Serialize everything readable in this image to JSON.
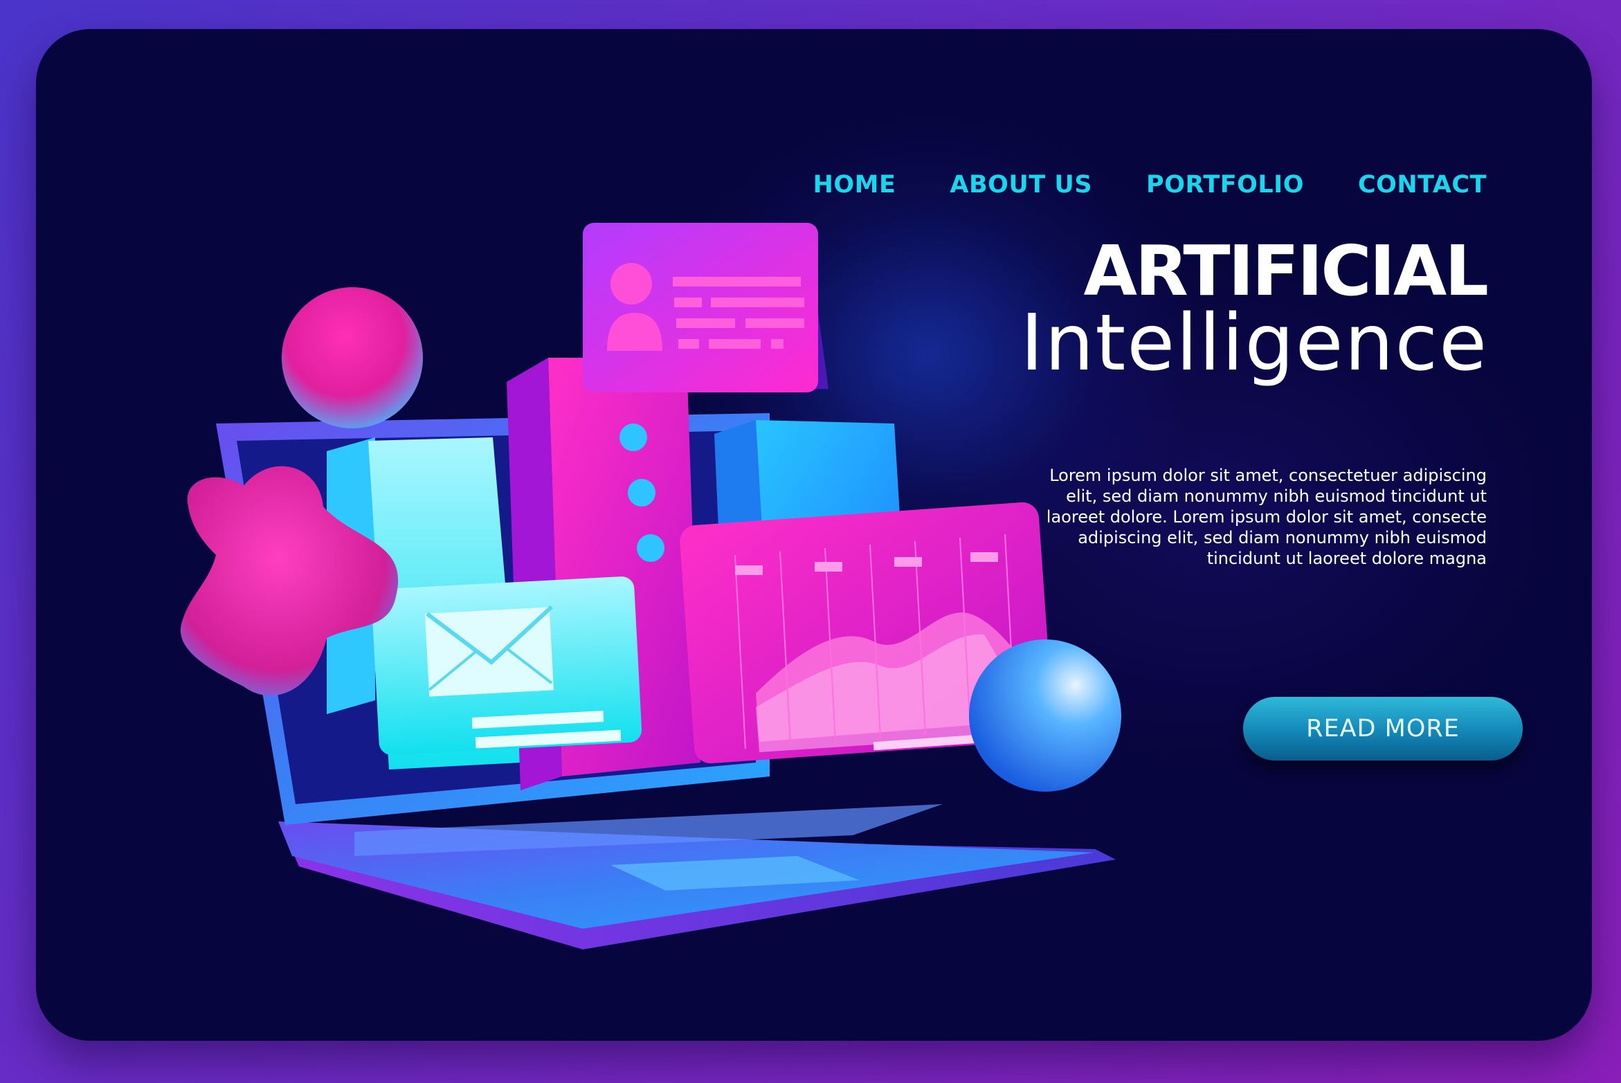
{
  "nav": {
    "items": [
      {
        "label": "HOME"
      },
      {
        "label": "ABOUT US"
      },
      {
        "label": "PORTFOLIO"
      },
      {
        "label": "CONTACT"
      }
    ]
  },
  "hero": {
    "title_line1": "ARTIFICIAL",
    "title_line2": "Intelligence",
    "body_lines": [
      "Lorem ipsum dolor sit amet, consectetuer adipiscing",
      "elit, sed diam nonummy nibh euismod tincidunt ut",
      "laoreet dolore. Lorem ipsum dolor sit amet, consecte",
      "adipiscing elit, sed diam nonummy nibh euismod",
      "tincidunt ut laoreet dolore magna"
    ],
    "cta_label": "READ MORE"
  },
  "colors": {
    "nav_accent": "#19d6ec",
    "background": "#07053d",
    "button": "#1a98c6",
    "magenta": "#ff1fb4",
    "cyan": "#12e0ee",
    "blue": "#2aa6ff"
  },
  "icons": {
    "email": "envelope-icon",
    "profile": "user-icon",
    "chart": "area-chart-icon"
  }
}
